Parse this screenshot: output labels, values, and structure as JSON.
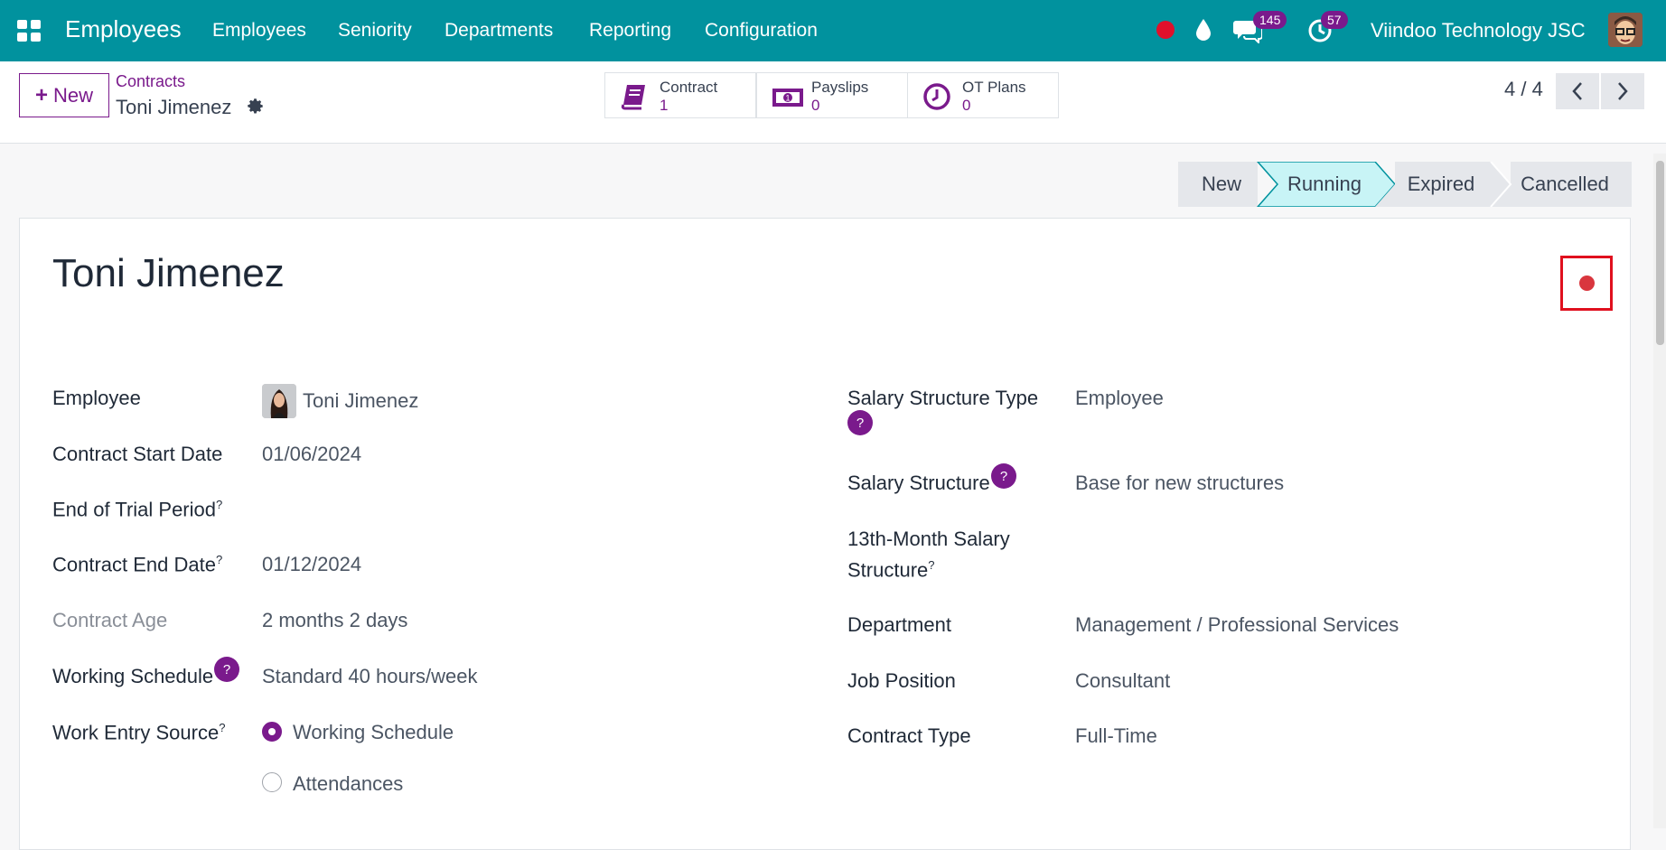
{
  "topbar": {
    "app_title": "Employees",
    "nav": [
      "Employees",
      "Seniority",
      "Departments",
      "Reporting",
      "Configuration"
    ],
    "messages_count": "145",
    "activities_count": "57",
    "company": "Viindoo Technology JSC",
    "accent_color": "#01929e"
  },
  "controlbar": {
    "new_label": "New",
    "breadcrumb_parent": "Contracts",
    "breadcrumb_current": "Toni Jimenez",
    "smart_buttons": [
      {
        "label": "Contract",
        "value": "1",
        "icon": "book-icon"
      },
      {
        "label": "Payslips",
        "value": "0",
        "icon": "money-icon"
      },
      {
        "label": "OT Plans",
        "value": "0",
        "icon": "clock-icon"
      }
    ],
    "pager": "4 / 4"
  },
  "status_bar": {
    "stages": [
      "New",
      "Running",
      "Expired",
      "Cancelled"
    ],
    "active": "Running"
  },
  "form": {
    "title": "Toni Jimenez",
    "left": {
      "employee": {
        "label": "Employee",
        "value": "Toni Jimenez"
      },
      "start_date": {
        "label": "Contract Start Date",
        "value": "01/06/2024"
      },
      "trial_end": {
        "label": "End of Trial Period",
        "value": ""
      },
      "end_date": {
        "label": "Contract End Date",
        "value": "01/12/2024"
      },
      "age": {
        "label": "Contract Age",
        "value": "2 months 2 days"
      },
      "schedule": {
        "label": "Working Schedule",
        "value": "Standard 40 hours/week"
      },
      "work_entry": {
        "label": "Work Entry Source",
        "options": [
          "Working Schedule",
          "Attendances"
        ],
        "selected": "Working Schedule"
      }
    },
    "right": {
      "structure_type": {
        "label": "Salary Structure Type",
        "value": "Employee"
      },
      "structure": {
        "label": "Salary Structure",
        "value": "Base for new structures"
      },
      "month13": {
        "label_line1": "13th-Month Salary",
        "label_line2": "Structure",
        "value": ""
      },
      "department": {
        "label": "Department",
        "value": "Management / Professional Services"
      },
      "job": {
        "label": "Job Position",
        "value": "Consultant"
      },
      "contract_type": {
        "label": "Contract Type",
        "value": "Full-Time"
      }
    }
  }
}
